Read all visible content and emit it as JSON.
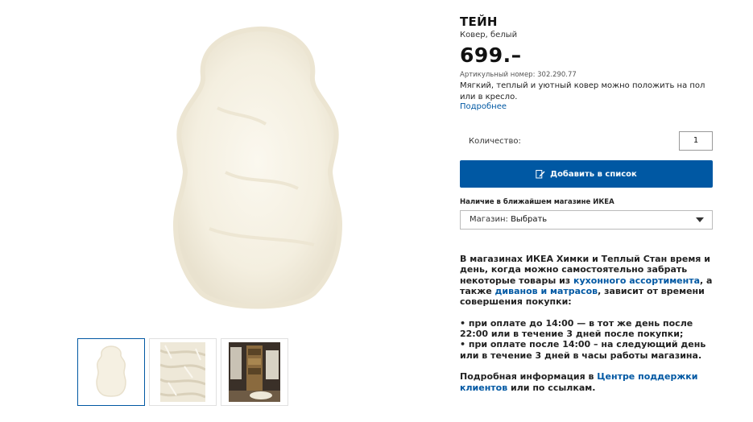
{
  "product": {
    "title": "ТЕЙН",
    "subtitle": "Ковер, белый",
    "price": "699.–",
    "article_number": "Артикульный номер: 302.290.77",
    "description": "Мягкий, теплый и уютный ковер можно положить на пол или в кресло.",
    "more_link": "Подробнее"
  },
  "images": {
    "main_icon": "sheepskin-rug-image",
    "thumbnails": [
      {
        "icon": "rug-thumbnail",
        "selected": true
      },
      {
        "icon": "fur-closeup-thumbnail",
        "selected": false
      },
      {
        "icon": "room-interior-thumbnail",
        "selected": false
      }
    ]
  },
  "quantity": {
    "label": "Количество:",
    "value": "1"
  },
  "add_button": {
    "label": "Добавить в список",
    "icon": "edit-list-icon",
    "color": "#0058a3"
  },
  "availability": {
    "label": "Наличие в ближайшем магазине ИКЕА",
    "select_label": "Магазин:",
    "select_value": "Выбрать"
  },
  "delivery": {
    "p1_a": "В магазинах ИКЕА Химки и Теплый Стан время и день, когда можно самостоятельно забрать некоторые товары из ",
    "p1_link1": "кухонного ассортимента",
    "p1_b": ", а также ",
    "p1_link2": "диванов и матрасов",
    "p1_c": ", зависит от времени совершения покупки:",
    "bullet1": "• при оплате до 14:00 — в тот же день после 22:00 или в течение 3 дней после покупки;",
    "bullet2": "• при оплате после 14:00 – на следующий день или в течение 3 дней в часы работы магазина.",
    "p3_a": "Подробная информация в ",
    "p3_link": "Центре поддержки клиентов",
    "p3_b": " или по ссылкам."
  },
  "colors": {
    "accent": "#0058a3",
    "rug": "#f6f1e4"
  }
}
